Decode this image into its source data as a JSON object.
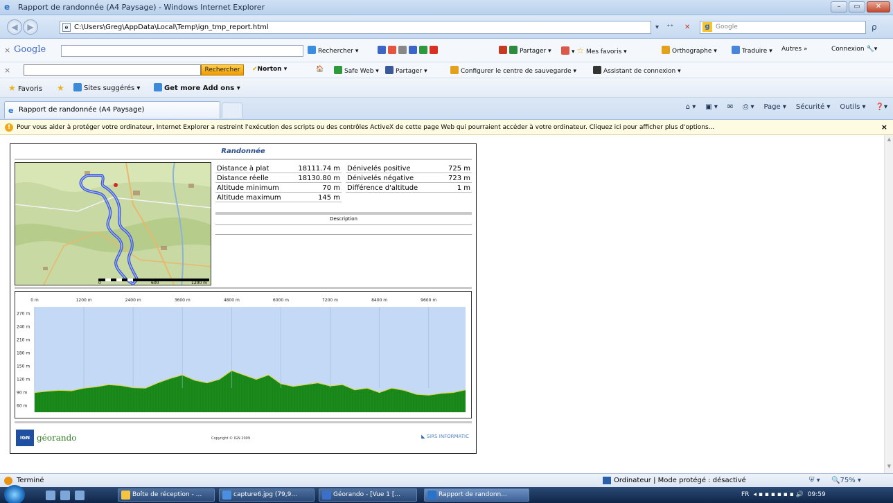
{
  "window": {
    "title": "Rapport de randonnée (A4 Paysage) - Windows Internet Explorer",
    "buttons": [
      "–",
      "▭",
      "✕"
    ]
  },
  "address": {
    "url": "C:\\Users\\Greg\\AppData\\Local\\Temp\\ign_tmp_report.html",
    "refresh": "⁺⁺",
    "stop": "✕",
    "search_placeholder": "Google",
    "search_go": "ρ"
  },
  "google_toolbar": {
    "logo": "Google",
    "search": "Rechercher",
    "share": "Partager",
    "favorites": "Mes favoris",
    "spell": "Orthographe",
    "translate": "Traduire",
    "more": "Autres »",
    "signin": "Connexion"
  },
  "norton_toolbar": {
    "search_button": "Rechercher",
    "norton": "Norton",
    "safeweb": "Safe Web",
    "share": "Partager",
    "backup": "Configurer le centre de sauvegarde",
    "assistant": "Assistant de connexion"
  },
  "favorites_bar": {
    "favorites": "Favoris",
    "suggested": "Sites suggérés",
    "addons": "Get more Add ons"
  },
  "tab": {
    "label": "Rapport de randonnée (A4 Paysage)"
  },
  "command_bar": [
    "Page",
    "Sécurité",
    "Outils"
  ],
  "info_bar": {
    "message": "Pour vous aider à protéger votre ordinateur, Internet Explorer a restreint l'exécution des scripts ou des contrôles ActiveX de cette page Web qui pourraient accéder à votre ordinateur. Cliquez ici pour afficher plus d'options...",
    "close": "×"
  },
  "report": {
    "title": "Randonnée",
    "stats_left": [
      {
        "label": "Distance à plat",
        "value": "18111.74 m"
      },
      {
        "label": "Distance réelle",
        "value": "18130.80 m"
      },
      {
        "label": "Altitude minimum",
        "value": "70 m"
      },
      {
        "label": "Altitude maximum",
        "value": "145 m"
      }
    ],
    "stats_right": [
      {
        "label": "Dénivelés positive",
        "value": "725 m"
      },
      {
        "label": "Dénivelés négative",
        "value": "723 m"
      },
      {
        "label": "Différence d'altitude",
        "value": "1 m"
      }
    ],
    "description_label": "Description",
    "map_scale": [
      "0",
      "600",
      "1200 m"
    ],
    "copyright": "Copyright © IGN 2009",
    "logo_left": "géorando",
    "logo_left_ign": "IGN",
    "logo_right": "SIRS INFORMATIC"
  },
  "chart_data": {
    "type": "area",
    "x_ticks": [
      "0 m",
      "1200 m",
      "2400 m",
      "3600 m",
      "4800 m",
      "6000 m",
      "7200 m",
      "8400 m",
      "9600 m"
    ],
    "y_ticks": [
      "270 m",
      "240 m",
      "210 m",
      "180 m",
      "150 m",
      "120 m",
      "90 m",
      "60 m"
    ],
    "x_range": [
      0,
      10500
    ],
    "y_range": [
      45,
      285
    ],
    "series": [
      {
        "x": [
          0,
          300,
          600,
          900,
          1200,
          1500,
          1800,
          2100,
          2400,
          2700,
          3000,
          3300,
          3600,
          3900,
          4200,
          4500,
          4800,
          5100,
          5400,
          5700,
          6000,
          6300,
          6600,
          6900,
          7200,
          7500,
          7800,
          8100,
          8400,
          8700,
          9000,
          9300,
          9600,
          9900,
          10200,
          10500
        ],
        "y": [
          90,
          93,
          95,
          94,
          100,
          103,
          108,
          106,
          101,
          100,
          112,
          122,
          130,
          118,
          112,
          120,
          140,
          130,
          120,
          130,
          110,
          104,
          108,
          112,
          105,
          108,
          96,
          100,
          90,
          100,
          95,
          86,
          84,
          88,
          90,
          96
        ]
      }
    ],
    "colors": {
      "area": "#1a8a1a",
      "background": "#c4d9f5",
      "line": "#d8d850"
    }
  },
  "status_bar": {
    "done": "Terminé",
    "zone": "Ordinateur | Mode protégé : désactivé",
    "zoom": "75%"
  },
  "taskbar": {
    "buttons": [
      {
        "label": "Boîte de réception - ...",
        "color": "#f5c542"
      },
      {
        "label": "capture6.jpg (79,9...",
        "color": "#4b8fe0"
      },
      {
        "label": "Géorando - [Vue 1 [...",
        "color": "#3a70c8"
      },
      {
        "label": "Rapport de randonn...",
        "color": "#2a74c8"
      }
    ],
    "lang": "FR",
    "time": "09:59"
  }
}
